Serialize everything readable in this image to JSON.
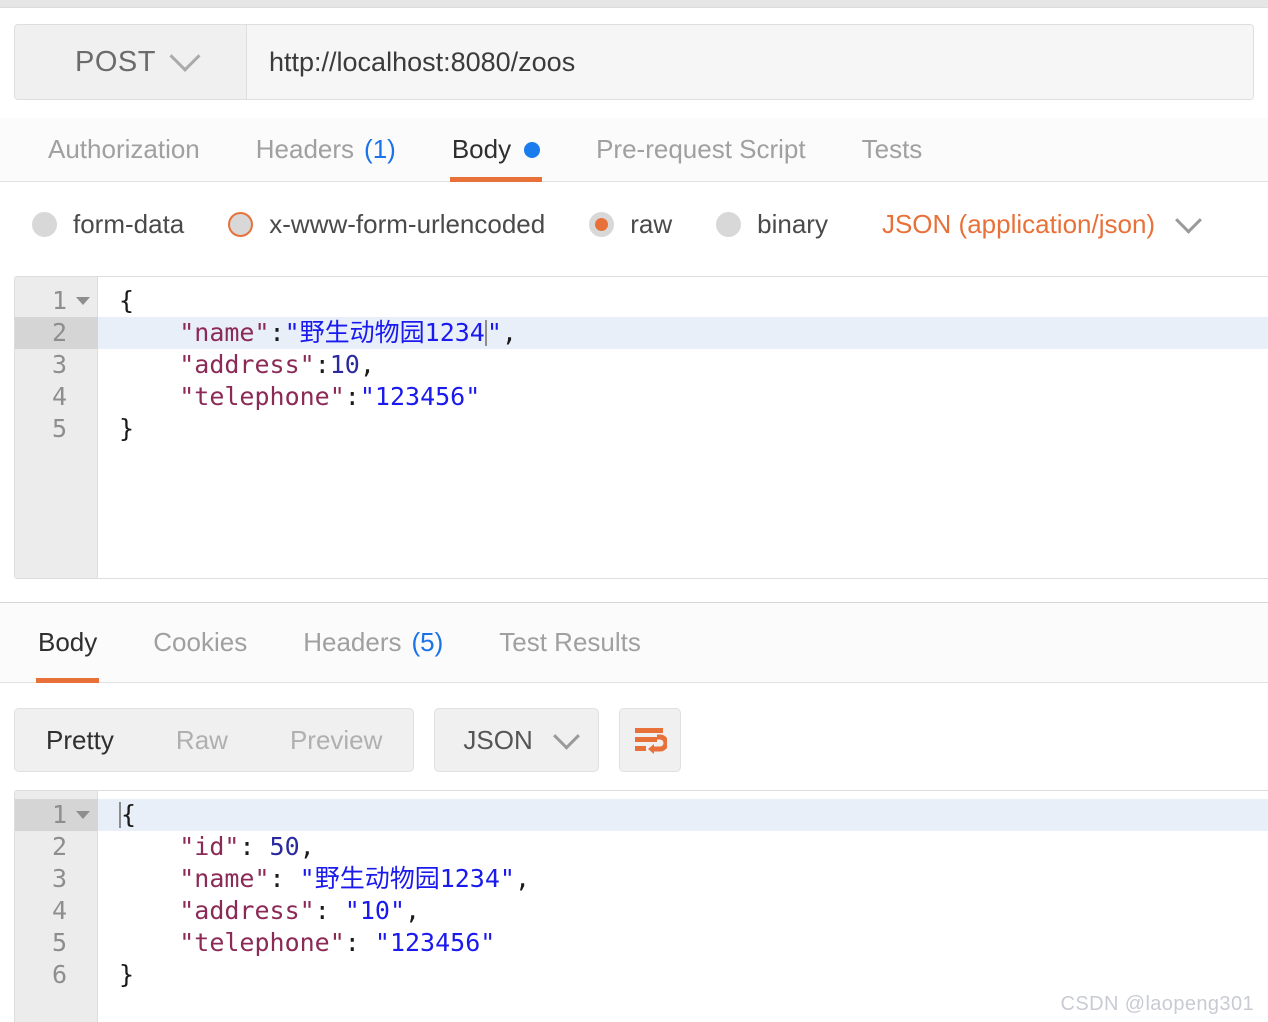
{
  "request": {
    "method": "POST",
    "url": "http://localhost:8080/zoos",
    "tabs": [
      {
        "label": "Authorization",
        "active": false,
        "count": "",
        "dot": false
      },
      {
        "label": "Headers",
        "active": false,
        "count": "(1)",
        "dot": false
      },
      {
        "label": "Body",
        "active": true,
        "count": "",
        "dot": true
      },
      {
        "label": "Pre-request Script",
        "active": false,
        "count": "",
        "dot": false
      },
      {
        "label": "Tests",
        "active": false,
        "count": "",
        "dot": false
      }
    ],
    "body_types": [
      {
        "label": "form-data",
        "state": "off"
      },
      {
        "label": "x-www-form-urlencoded",
        "state": "hovered"
      },
      {
        "label": "raw",
        "state": "checked"
      },
      {
        "label": "binary",
        "state": "off"
      }
    ],
    "content_type": "JSON (application/json)",
    "editor": {
      "lines": [
        {
          "no": "1",
          "fold": true,
          "active": false,
          "tokens": [
            {
              "t": "pun",
              "v": "{"
            }
          ]
        },
        {
          "no": "2",
          "fold": false,
          "active": true,
          "tokens": [
            {
              "t": "pun",
              "v": "    "
            },
            {
              "t": "key",
              "v": "\"name\""
            },
            {
              "t": "pun",
              "v": ":"
            },
            {
              "t": "str",
              "v": "\"野生动物园1234"
            },
            {
              "t": "caret",
              "v": ""
            },
            {
              "t": "str",
              "v": "\""
            },
            {
              "t": "pun",
              "v": ","
            }
          ]
        },
        {
          "no": "3",
          "fold": false,
          "active": false,
          "tokens": [
            {
              "t": "pun",
              "v": "    "
            },
            {
              "t": "key",
              "v": "\"address\""
            },
            {
              "t": "pun",
              "v": ":"
            },
            {
              "t": "num",
              "v": "10"
            },
            {
              "t": "pun",
              "v": ","
            }
          ]
        },
        {
          "no": "4",
          "fold": false,
          "active": false,
          "tokens": [
            {
              "t": "pun",
              "v": "    "
            },
            {
              "t": "key",
              "v": "\"telephone\""
            },
            {
              "t": "pun",
              "v": ":"
            },
            {
              "t": "str",
              "v": "\"123456\""
            }
          ]
        },
        {
          "no": "5",
          "fold": false,
          "active": false,
          "tokens": [
            {
              "t": "pun",
              "v": "}"
            }
          ]
        }
      ]
    }
  },
  "response": {
    "tabs": [
      {
        "label": "Body",
        "active": true,
        "count": ""
      },
      {
        "label": "Cookies",
        "active": false,
        "count": ""
      },
      {
        "label": "Headers",
        "active": false,
        "count": "(5)"
      },
      {
        "label": "Test Results",
        "active": false,
        "count": ""
      }
    ],
    "view_modes": [
      {
        "label": "Pretty",
        "active": true
      },
      {
        "label": "Raw",
        "active": false
      },
      {
        "label": "Preview",
        "active": false
      }
    ],
    "format": "JSON",
    "wrap_icon": "word-wrap-icon",
    "editor": {
      "lines": [
        {
          "no": "1",
          "fold": true,
          "active": true,
          "tokens": [
            {
              "t": "caret",
              "v": ""
            },
            {
              "t": "pun",
              "v": "{"
            }
          ]
        },
        {
          "no": "2",
          "fold": false,
          "active": false,
          "tokens": [
            {
              "t": "pun",
              "v": "    "
            },
            {
              "t": "key",
              "v": "\"id\""
            },
            {
              "t": "pun",
              "v": ": "
            },
            {
              "t": "num",
              "v": "50"
            },
            {
              "t": "pun",
              "v": ","
            }
          ]
        },
        {
          "no": "3",
          "fold": false,
          "active": false,
          "tokens": [
            {
              "t": "pun",
              "v": "    "
            },
            {
              "t": "key",
              "v": "\"name\""
            },
            {
              "t": "pun",
              "v": ": "
            },
            {
              "t": "str",
              "v": "\"野生动物园1234\""
            },
            {
              "t": "pun",
              "v": ","
            }
          ]
        },
        {
          "no": "4",
          "fold": false,
          "active": false,
          "tokens": [
            {
              "t": "pun",
              "v": "    "
            },
            {
              "t": "key",
              "v": "\"address\""
            },
            {
              "t": "pun",
              "v": ": "
            },
            {
              "t": "str",
              "v": "\"10\""
            },
            {
              "t": "pun",
              "v": ","
            }
          ]
        },
        {
          "no": "5",
          "fold": false,
          "active": false,
          "tokens": [
            {
              "t": "pun",
              "v": "    "
            },
            {
              "t": "key",
              "v": "\"telephone\""
            },
            {
              "t": "pun",
              "v": ": "
            },
            {
              "t": "str",
              "v": "\"123456\""
            }
          ]
        },
        {
          "no": "6",
          "fold": false,
          "active": false,
          "tokens": [
            {
              "t": "pun",
              "v": "}"
            }
          ]
        }
      ]
    }
  },
  "watermark": "CSDN @laopeng301",
  "colors": {
    "accent": "#e8713a",
    "blue_dot": "#1b7ced",
    "count_blue": "#1a73e8",
    "json_key": "#8b2a56",
    "json_string": "#1a1aee",
    "json_number": "#2a2a9e",
    "active_line": "#e8eff9",
    "gutter": "#ececec"
  }
}
